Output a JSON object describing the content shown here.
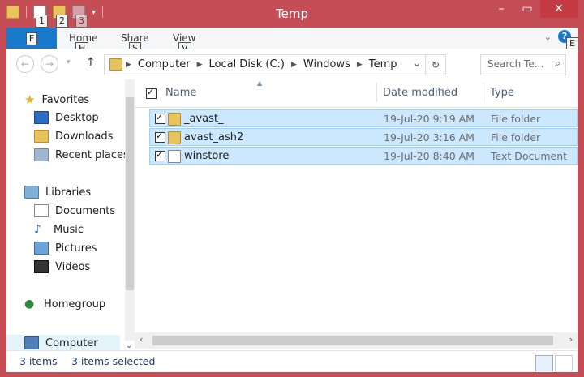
{
  "window": {
    "title": "Temp"
  },
  "qat": {
    "keytips": [
      "1",
      "2",
      "3"
    ]
  },
  "ribbon": {
    "file_tab": "F",
    "tabs": [
      {
        "label": "Home",
        "keytip": "H"
      },
      {
        "label": "Share",
        "keytip": "S"
      },
      {
        "label": "View",
        "keytip": "V"
      }
    ],
    "help_keytip": "E"
  },
  "address": {
    "crumbs": [
      "Computer",
      "Local Disk (C:)",
      "Windows",
      "Temp"
    ]
  },
  "search": {
    "placeholder": "Search Te..."
  },
  "nav": {
    "favorites": "Favorites",
    "desktop": "Desktop",
    "downloads": "Downloads",
    "recent": "Recent places",
    "libraries": "Libraries",
    "documents": "Documents",
    "music": "Music",
    "pictures": "Pictures",
    "videos": "Videos",
    "homegroup": "Homegroup",
    "computer": "Computer"
  },
  "columns": {
    "name": "Name",
    "date": "Date modified",
    "type": "Type"
  },
  "files": [
    {
      "name": "_avast_",
      "date": "19-Jul-20 9:19 AM",
      "type": "File folder",
      "icon": "folder"
    },
    {
      "name": "avast_ash2",
      "date": "19-Jul-20 3:16 AM",
      "type": "File folder",
      "icon": "folder"
    },
    {
      "name": "winstore",
      "date": "19-Jul-20 8:40 AM",
      "type": "Text Document",
      "icon": "text-file"
    }
  ],
  "status": {
    "count": "3 items",
    "selected": "3 items selected"
  },
  "colors": {
    "frame": "#c44d56",
    "accent": "#1979ca",
    "selection": "#cce8ff"
  }
}
